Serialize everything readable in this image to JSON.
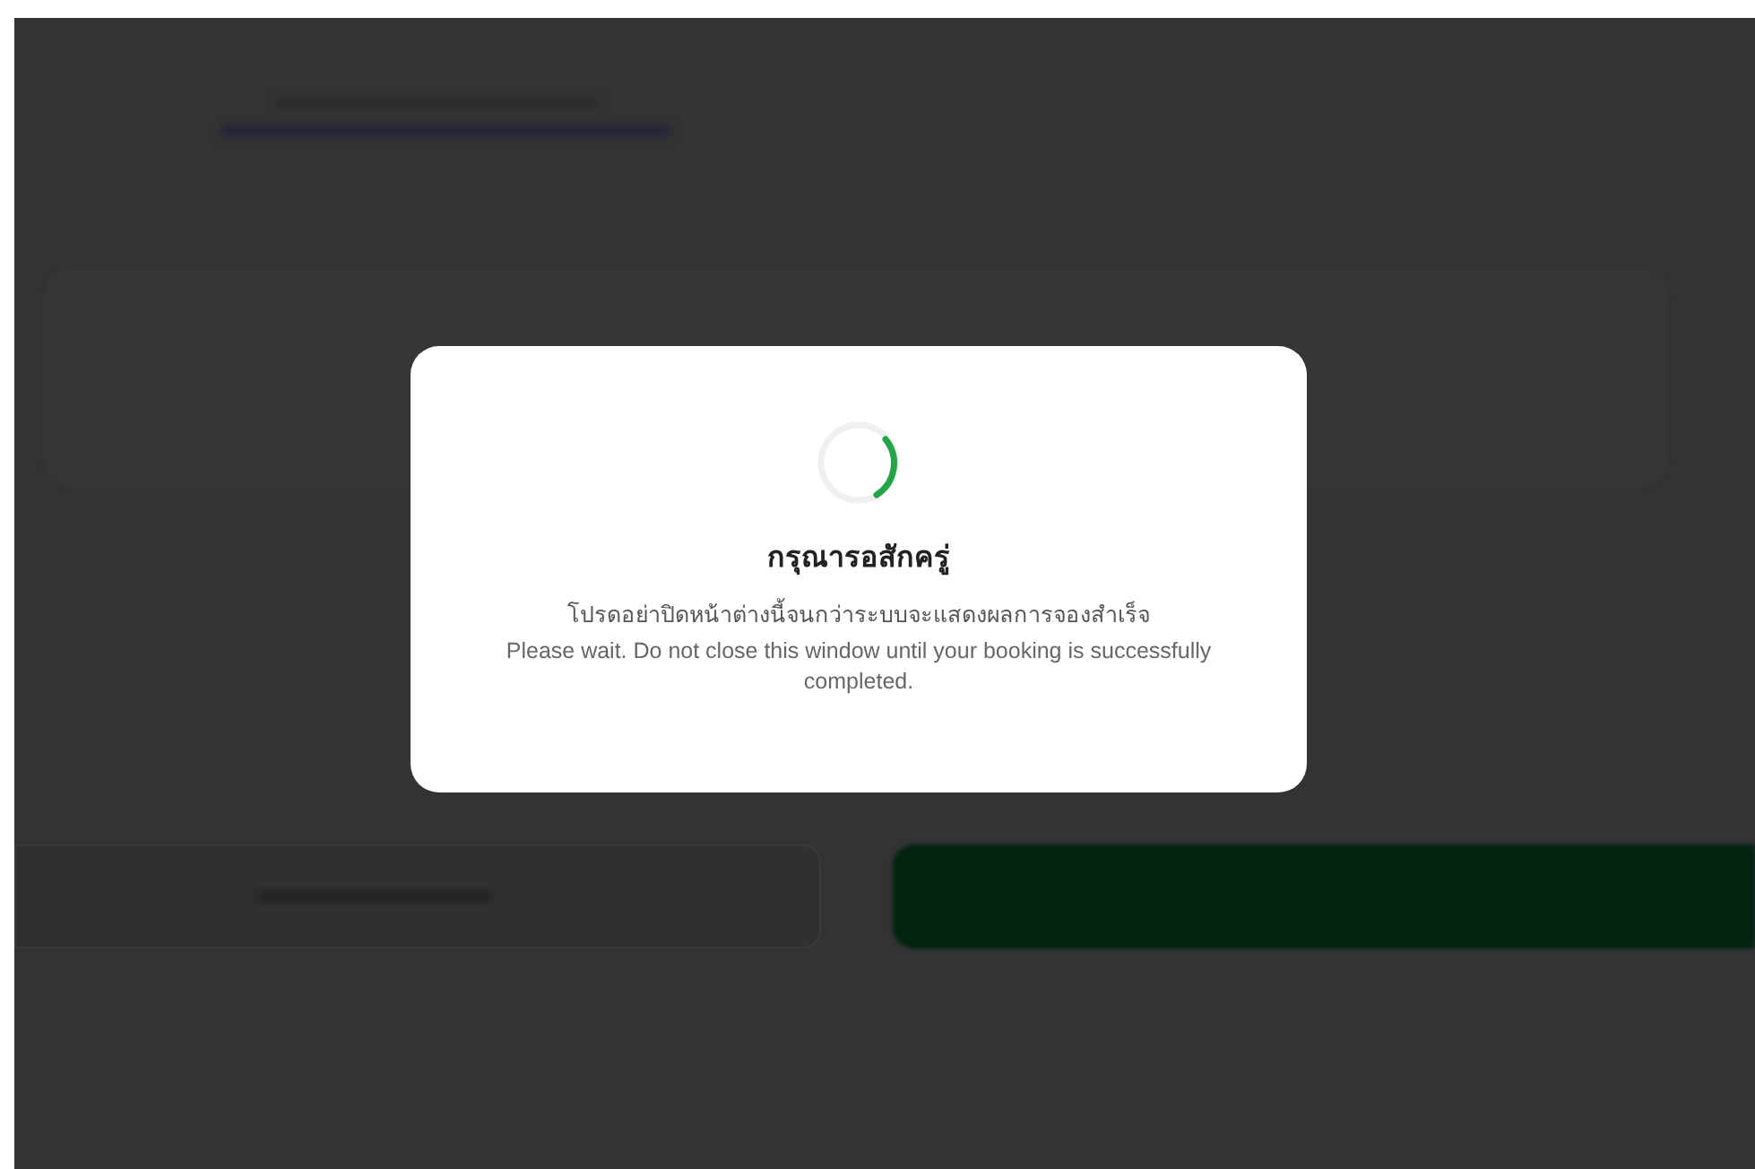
{
  "dialog": {
    "title": "กรุณารอสักครู่",
    "message_thai": "โปรดอย่าปิดหน้าต่างนี้จนกว่าระบบจะแสดงผลการจองสำเร็จ",
    "message_english": "Please wait. Do not close this window until your booking is successfully completed."
  }
}
